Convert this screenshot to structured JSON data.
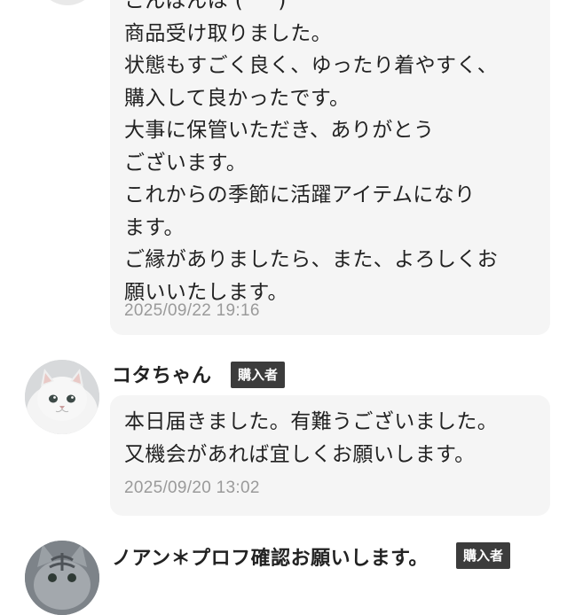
{
  "reviews": [
    {
      "lines": [
        "こんばんは (^^)",
        "商品受け取りました。",
        "状態もすごく良く、ゆったり着やすく、",
        "購入して良かったです。",
        "大事に保管いただき、ありがとう",
        "ございます。",
        "これからの季節に活躍アイテムになり",
        "ます。",
        "ご縁がありましたら、また、よろしくお",
        "願いいたします。"
      ],
      "timestamp": "2025/09/22 19:16"
    },
    {
      "name": "コタちゃん",
      "badge": "購入者",
      "avatar": "white-persian-cat-avatar",
      "lines": [
        "本日届きました。有難うございました。",
        "又機会があれば宜しくお願いします。"
      ],
      "timestamp": "2025/09/20 13:02"
    },
    {
      "name": "ノアン＊プロフ確認お願いします。",
      "badge": "購入者",
      "avatar": "gray-tabby-cat-avatar"
    }
  ]
}
